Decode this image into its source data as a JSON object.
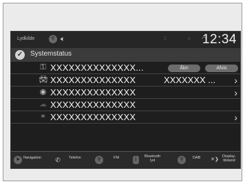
{
  "statusbar": {
    "source": "Lydkilde",
    "clock": "12:34"
  },
  "title": "Systemstatus",
  "rows": [
    {
      "text": "XXXXXXXXXXXXXX...",
      "pill1": "Åbn",
      "pill2": "Afvis"
    },
    {
      "text": "XXXXXXXXXXXXXX",
      "value": "XXXXXXX ..."
    },
    {
      "text": "XXXXXXXXXXXXXX"
    },
    {
      "text": "XXXXXXXXXXXXXX"
    },
    {
      "text": "XXXXXXXXXXXXXX"
    }
  ],
  "bottombar": {
    "navigation": "Navigation",
    "telefon": "Telefon",
    "fm": "FM",
    "bluetooth_line1": "Bluetooth",
    "bluetooth_line2": "lyd",
    "dab": "DAB",
    "display_line1": "Display-",
    "display_line2": "tilstand"
  },
  "icons": {
    "check": "check-icon",
    "lock": "lock-icon",
    "car": "car-icon",
    "wifi": "wifi-icon",
    "cloud": "cloud-icon",
    "satellite": "satellite-icon"
  }
}
